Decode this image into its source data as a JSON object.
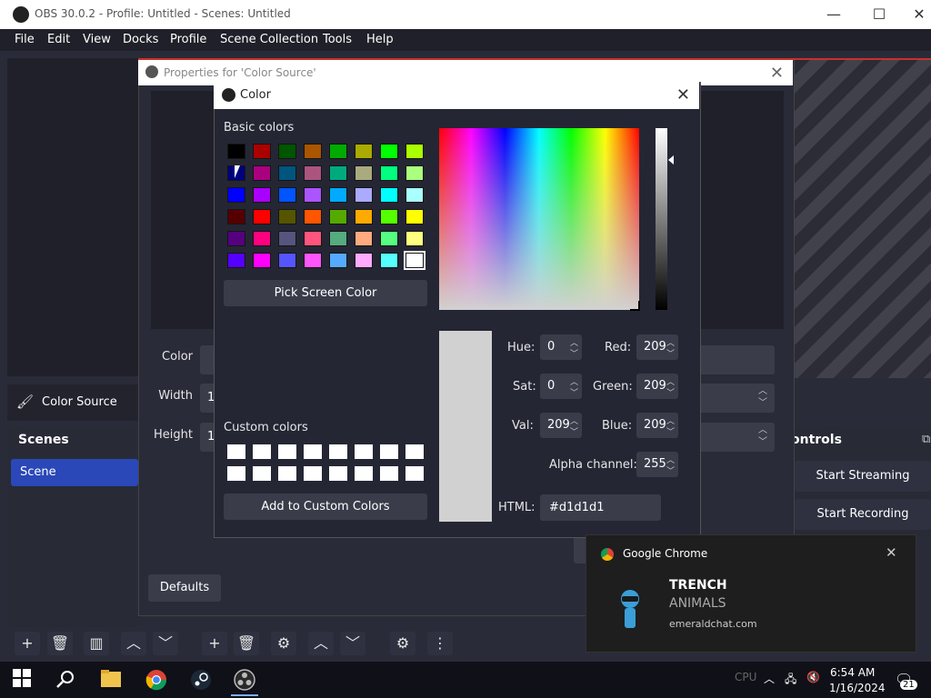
{
  "window": {
    "title": "OBS 30.0.2 - Profile: Untitled - Scenes: Untitled",
    "minimize": "—",
    "maximize": "☐",
    "close": "✕"
  },
  "menu": [
    "File",
    "Edit",
    "View",
    "Docks",
    "Profile",
    "Scene Collection",
    "Tools",
    "Help"
  ],
  "sources": {
    "item": "Color Source"
  },
  "scenes": {
    "title": "Scenes",
    "item": "Scene"
  },
  "controls": {
    "title": "ontrols",
    "start_streaming": "Start Streaming",
    "start_recording": "Start Recording"
  },
  "properties": {
    "title": "Properties for 'Color Source'",
    "color_label": "Color",
    "width_label": "Width",
    "width_value": "1",
    "height_label": "Height",
    "height_value": "1",
    "defaults": "Defaults"
  },
  "color_dialog": {
    "title": "Color",
    "basic_colors_label": "Basic colors",
    "basic_colors": [
      [
        "#000000",
        "#aa0000",
        "#005500",
        "#aa5500",
        "#00aa00",
        "#aaaa00",
        "#00ff00",
        "#aaff00"
      ],
      [
        "#00007f",
        "#aa007f",
        "#00557f",
        "#aa557f",
        "#00aa7f",
        "#aaaa7f",
        "#00ff7f",
        "#aaff7f"
      ],
      [
        "#0000ff",
        "#aa00ff",
        "#0055ff",
        "#aa55ff",
        "#00aaff",
        "#aaaaff",
        "#00ffff",
        "#aaffff"
      ],
      [
        "#550000",
        "#ff0000",
        "#555500",
        "#ff5500",
        "#55aa00",
        "#ffaa00",
        "#55ff00",
        "#ffff00"
      ],
      [
        "#55007f",
        "#ff007f",
        "#55557f",
        "#ff557f",
        "#55aa7f",
        "#ffaa7f",
        "#55ff7f",
        "#ffff7f"
      ],
      [
        "#5500ff",
        "#ff00ff",
        "#5555ff",
        "#ff55ff",
        "#55aaff",
        "#ffaaff",
        "#55ffff",
        "#ffffff"
      ]
    ],
    "pick_screen": "Pick Screen Color",
    "custom_colors_label": "Custom colors",
    "add_custom": "Add to Custom Colors",
    "hue_label": "Hue:",
    "hue": "0",
    "sat_label": "Sat:",
    "sat": "0",
    "val_label": "Val:",
    "val": "209",
    "red_label": "Red:",
    "red": "209",
    "green_label": "Green:",
    "green": "209",
    "blue_label": "Blue:",
    "blue": "209",
    "alpha_label": "Alpha channel:",
    "alpha": "255",
    "html_label": "HTML:",
    "html": "#d1d1d1",
    "current_color": "#d1d1d1"
  },
  "toast": {
    "app": "Google Chrome",
    "line1": "TRENCH",
    "line2": "ANIMALS",
    "source": "emeraldchat.com"
  },
  "taskbar": {
    "time": "6:54 AM",
    "date": "1/16/2024",
    "badge": "21",
    "cpu": "CPU"
  }
}
